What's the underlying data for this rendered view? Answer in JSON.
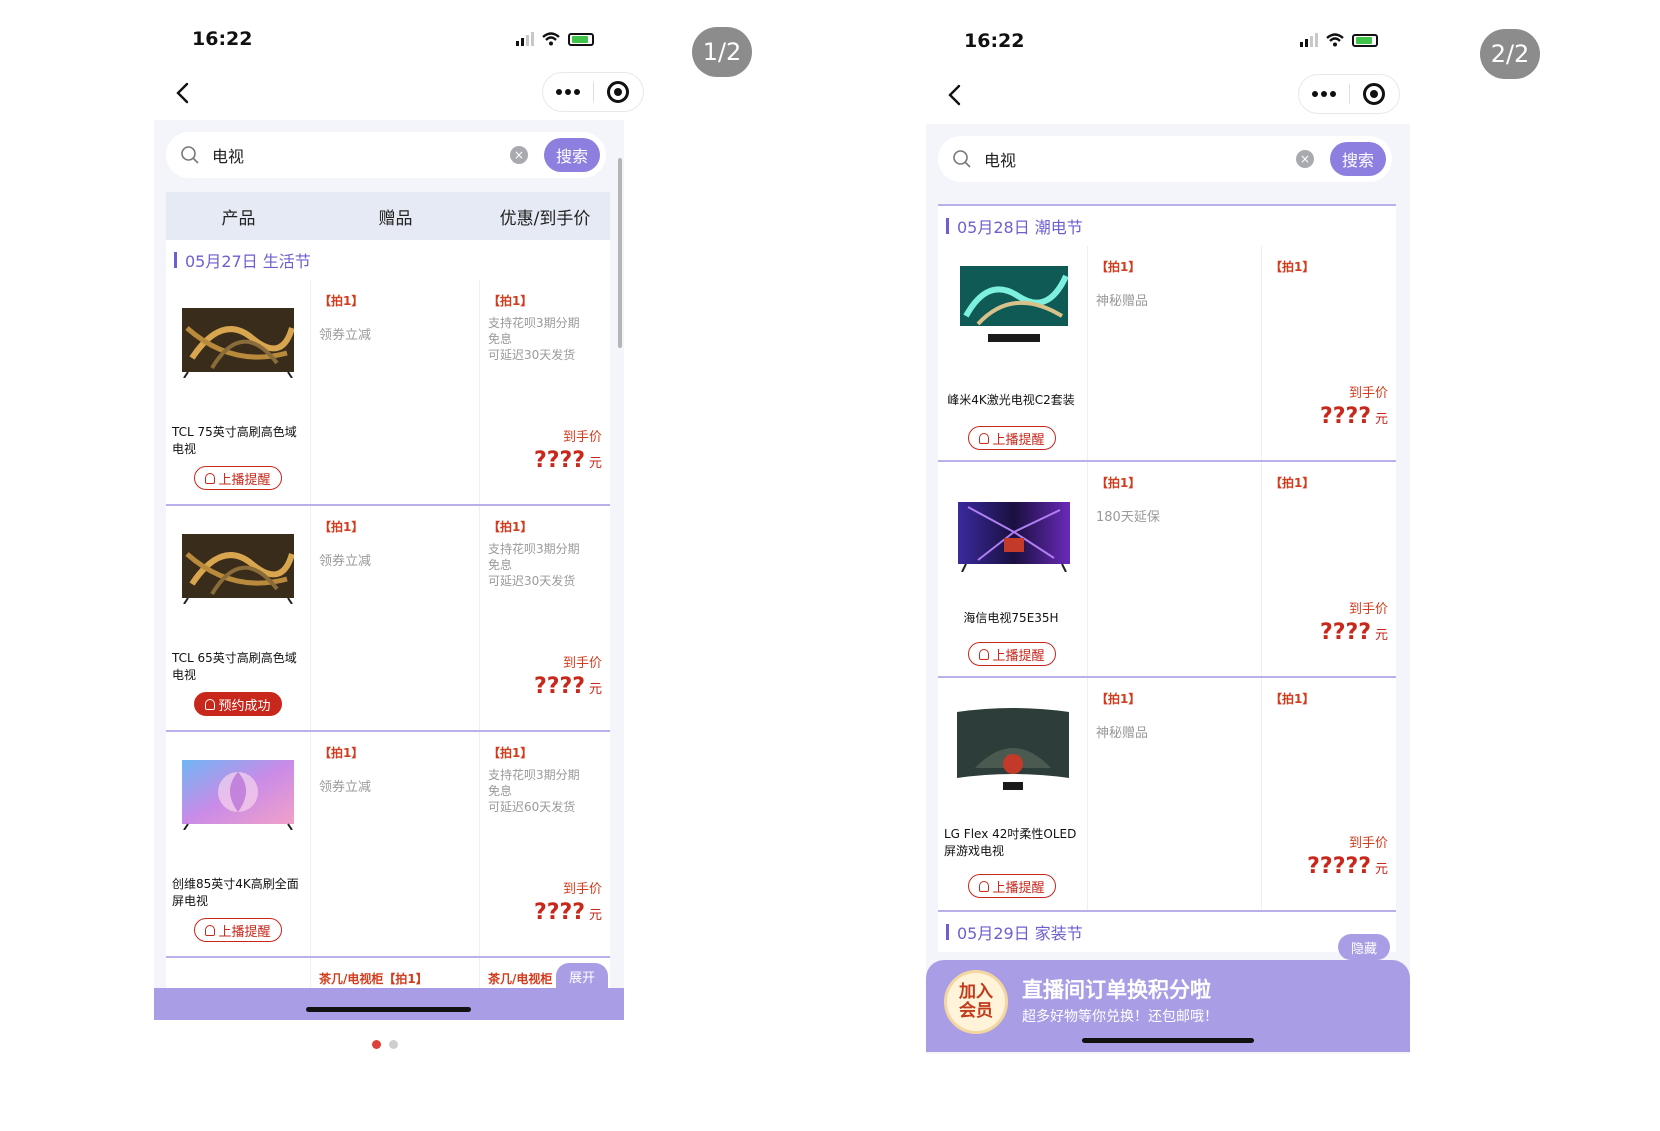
{
  "badges": {
    "left": "1/2",
    "right": "2/2"
  },
  "status": {
    "time": "16:22"
  },
  "search": {
    "query": "电视",
    "button": "搜索",
    "clear": "×"
  },
  "columns": [
    "产品",
    "赠品",
    "优惠/到手价"
  ],
  "common": {
    "price_label": "到手价",
    "yuan": "元",
    "tag": "【拍1】"
  },
  "left": {
    "section": "05月27日 生活节",
    "rows": [
      {
        "name": "TCL 75英寸高刷高色域电视",
        "gift": "领券立减",
        "promo": [
          "支持花呗3期分期",
          "免息",
          "可延迟30天发货"
        ],
        "price": "????",
        "remind": "上播提醒",
        "remind_done": false
      },
      {
        "name": "TCL 65英寸高刷高色域电视",
        "gift": "领券立减",
        "promo": [
          "支持花呗3期分期",
          "免息",
          "可延迟30天发货"
        ],
        "price": "????",
        "remind": "预约成功",
        "remind_done": true
      },
      {
        "name": "创维85英寸4K高刷全面屏电视",
        "gift": "领券立减",
        "promo": [
          "支持花呗3期分期",
          "免息",
          "可延迟60天发货"
        ],
        "price": "????",
        "remind": "上播提醒",
        "remind_done": false
      }
    ],
    "next_gift": "茶几/电视柜【拍1】",
    "next_promo": "茶几/电视柜",
    "expand": "展开"
  },
  "right": {
    "section": "05月28日 潮电节",
    "rows": [
      {
        "name": "峰米4K激光电视C2套装",
        "gift": "神秘赠品",
        "price": "????",
        "remind": "上播提醒"
      },
      {
        "name": "海信电视75E35H",
        "gift": "180天延保",
        "price": "????",
        "remind": "上播提醒"
      },
      {
        "name": "LG Flex 42吋柔性OLED屏游戏电视",
        "gift": "神秘赠品",
        "price": "?????",
        "remind": "上播提醒"
      }
    ],
    "next_section": "05月29日 家装节",
    "hide": "隐藏",
    "banner": {
      "badge_top": "加入",
      "badge_bottom": "会员",
      "title": "直播间订单换积分啦",
      "subtitle": "超多好物等你兑换！还包邮哦！"
    }
  },
  "colors": {
    "accent": "#8d7fe0",
    "price_red": "#c8281b",
    "section_purple": "#6c5fd0"
  }
}
